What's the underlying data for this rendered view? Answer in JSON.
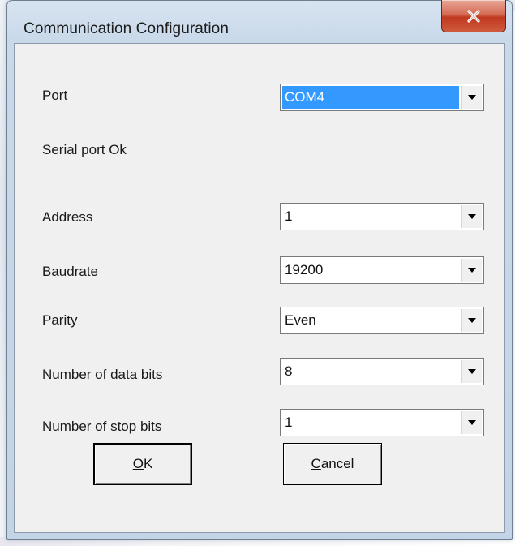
{
  "window": {
    "title": "Communication Configuration",
    "close_symbol": "✕"
  },
  "form": {
    "port": {
      "label": "Port",
      "value": "COM4"
    },
    "status_text": "Serial port Ok",
    "address": {
      "label": "Address",
      "value": "1"
    },
    "baudrate": {
      "label": "Baudrate",
      "value": "19200"
    },
    "parity": {
      "label": "Parity",
      "value": "Even"
    },
    "data_bits": {
      "label": "Number of data bits",
      "value": "8"
    },
    "stop_bits": {
      "label": "Number of stop bits",
      "value": "1"
    }
  },
  "buttons": {
    "ok": {
      "mnemonic": "O",
      "rest": "K"
    },
    "cancel": {
      "mnemonic": "C",
      "rest": "ancel"
    }
  },
  "colors": {
    "selection": "#3399ff",
    "close_button": "#c74a30"
  },
  "icons": {
    "close": "close-icon",
    "dropdown": "chevron-down-icon"
  }
}
